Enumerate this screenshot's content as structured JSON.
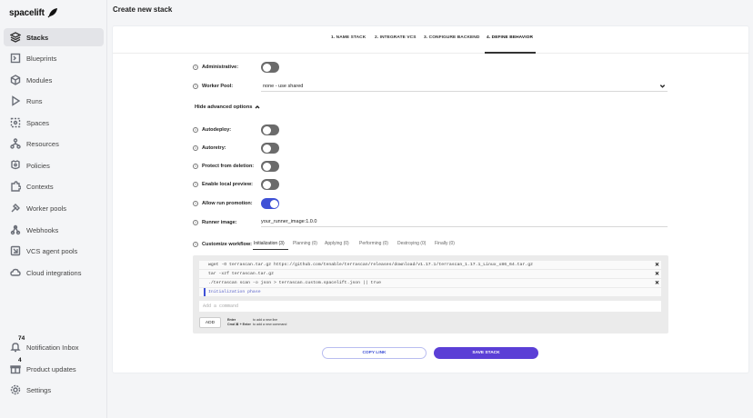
{
  "app": {
    "logo_text": "spacelift"
  },
  "sidebar": {
    "items": [
      {
        "label": "Stacks",
        "icon": "layers-icon"
      },
      {
        "label": "Blueprints",
        "icon": "blueprint-icon"
      },
      {
        "label": "Modules",
        "icon": "cube-icon"
      },
      {
        "label": "Runs",
        "icon": "play-icon"
      },
      {
        "label": "Spaces",
        "icon": "spaces-icon"
      },
      {
        "label": "Resources",
        "icon": "resources-icon"
      },
      {
        "label": "Policies",
        "icon": "policies-icon"
      },
      {
        "label": "Contexts",
        "icon": "puzzle-icon"
      },
      {
        "label": "Worker pools",
        "icon": "worker-pools-icon"
      },
      {
        "label": "Webhooks",
        "icon": "webhook-icon"
      },
      {
        "label": "VCS agent pools",
        "icon": "vcs-icon"
      },
      {
        "label": "Cloud integrations",
        "icon": "cloud-icon"
      }
    ],
    "bottom": [
      {
        "label": "Notification Inbox",
        "icon": "bell-icon",
        "badge": "74"
      },
      {
        "label": "Product updates",
        "icon": "gift-icon",
        "badge": "4"
      },
      {
        "label": "Settings",
        "icon": "gear-icon"
      }
    ]
  },
  "header": {
    "title": "Create new stack"
  },
  "steps": [
    "1. NAME STACK",
    "2. INTEGRATE VCS",
    "3. CONFIGURE BACKEND",
    "4. DEFINE BEHAVIOR"
  ],
  "form": {
    "administrative_label": "Administrative:",
    "worker_pool_label": "Worker Pool:",
    "worker_pool_value": "none - use shared",
    "advanced_toggle": "Hide advanced options",
    "autodeploy_label": "Autodeploy:",
    "autoretry_label": "Autoretry:",
    "protect_label": "Protect from deletion:",
    "local_preview_label": "Enable local preview:",
    "run_promotion_label": "Allow run promotion:",
    "runner_image_label": "Runner image:",
    "runner_image_value": "your_runner_image:1.0.0",
    "workflow_label": "Customize workflow:",
    "toggles": {
      "administrative": false,
      "autodeploy": false,
      "autoretry": false,
      "protect": false,
      "local_preview": false,
      "run_promotion": true
    }
  },
  "workflow": {
    "tabs": [
      "Initialization (3)",
      "Planning (0)",
      "Applying (0)",
      "Performing (0)",
      "Destroying (0)",
      "Finally (0)"
    ],
    "commands": [
      "wget -O terrascan.tar.gz https://github.com/tenable/terrascan/releases/download/v1.17.1/terrascan_1.17.1_Linux_x86_64.tar.gz",
      "tar -xzf terrascan.tar.gz",
      "./terrascan scan -o json > terrascan.custom.spacelift.json || true"
    ],
    "phase_marker": "Initialization phase",
    "command_placeholder": "Add a command",
    "add_label": "ADD",
    "hint_keys": [
      "Enter",
      "Cmd ⌘ + Enter"
    ],
    "hint_texts": [
      "to add a new line",
      "to add a new command"
    ]
  },
  "actions": {
    "copy_link": "COPY LINK",
    "save_stack": "SAVE STACK"
  },
  "colors": {
    "accent": "#3f51d6",
    "save": "#5b3fd6",
    "toggle_off": "#6b6b6b"
  }
}
